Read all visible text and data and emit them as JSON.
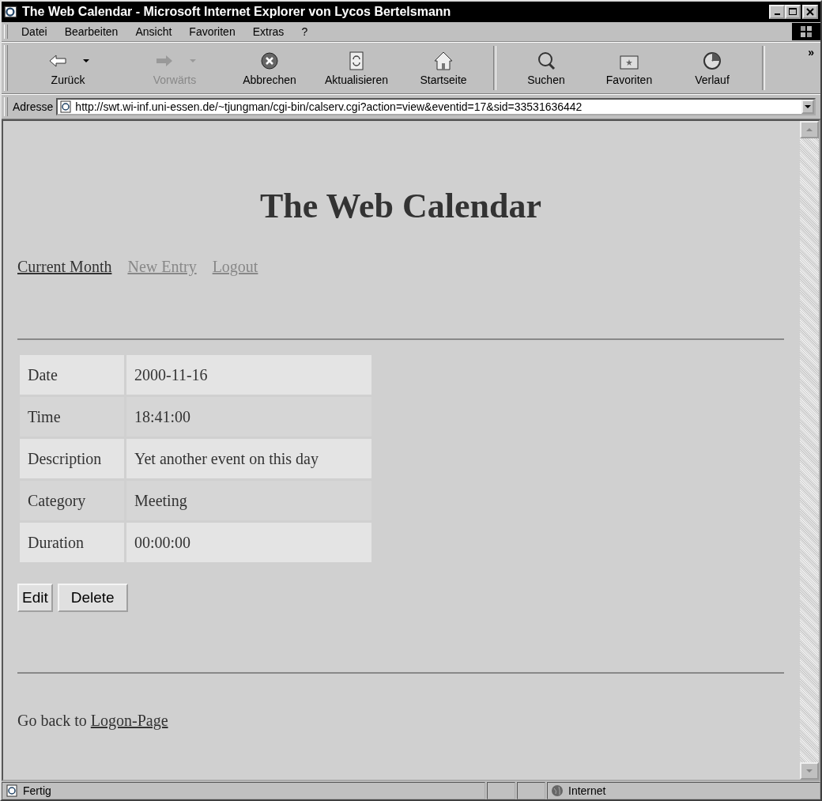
{
  "window": {
    "title": "The Web Calendar - Microsoft Internet Explorer von Lycos Bertelsmann"
  },
  "menu": [
    "Datei",
    "Bearbeiten",
    "Ansicht",
    "Favoriten",
    "Extras",
    "?"
  ],
  "toolbar": [
    {
      "kind": "back",
      "label": "Zurück",
      "disabled": false,
      "dropdown": true
    },
    {
      "kind": "forward",
      "label": "Vorwärts",
      "disabled": true,
      "dropdown": true
    },
    {
      "kind": "stop",
      "label": "Abbrechen",
      "disabled": false,
      "dropdown": false
    },
    {
      "kind": "refresh",
      "label": "Aktualisieren",
      "disabled": false,
      "dropdown": false
    },
    {
      "kind": "home",
      "label": "Startseite",
      "disabled": false,
      "dropdown": false
    },
    {
      "kind": "search",
      "label": "Suchen",
      "disabled": false,
      "dropdown": false
    },
    {
      "kind": "favorites",
      "label": "Favoriten",
      "disabled": false,
      "dropdown": false
    },
    {
      "kind": "history",
      "label": "Verlauf",
      "disabled": false,
      "dropdown": false
    }
  ],
  "toolbar_more": "»",
  "address": {
    "label": "Adresse",
    "value": "http://swt.wi-inf.uni-essen.de/~tjungman/cgi-bin/calserv.cgi?action=view&eventid=17&sid=33531636442"
  },
  "page": {
    "heading": "The Web Calendar",
    "nav_links": [
      {
        "label": "Current Month",
        "visited": false
      },
      {
        "label": "New Entry",
        "visited": true
      },
      {
        "label": "Logout",
        "visited": true
      }
    ],
    "details": [
      {
        "label": "Date",
        "value": "2000-11-16"
      },
      {
        "label": "Time",
        "value": "18:41:00"
      },
      {
        "label": "Description",
        "value": "Yet another event on this day"
      },
      {
        "label": "Category",
        "value": "Meeting"
      },
      {
        "label": "Duration",
        "value": "00:00:00"
      }
    ],
    "buttons": [
      "Edit",
      "Delete"
    ],
    "footer_text": "Go back to ",
    "footer_link": "Logon-Page"
  },
  "status_bar": {
    "text": "Fertig",
    "zone": "Internet"
  }
}
